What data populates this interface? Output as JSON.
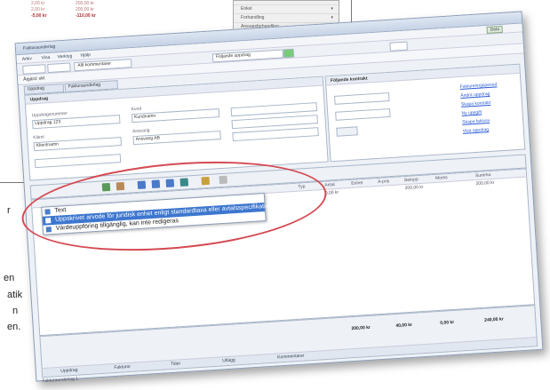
{
  "background": {
    "table_rows": [
      {
        "a": "2,00 kr",
        "b": "200,00 kr"
      },
      {
        "a": "2,00 kr",
        "b": "200,00 kr"
      },
      {
        "a": "-5,00 kr",
        "b": "-110,00 kr"
      }
    ],
    "menu_items": [
      "Enkel",
      "Forhandling",
      "Ansvarsforhandling"
    ],
    "side_text_left": [
      "r",
      "en",
      "atik",
      "n",
      "en."
    ]
  },
  "window": {
    "title": "Fakturaunderlag",
    "menu": [
      "Arkiv",
      "Visa",
      "Verktyg",
      "Hjälp"
    ],
    "right_button": "Dela",
    "toolbar": {
      "field1": "Allt kommentarer",
      "dropdown": "Följande uppdrag"
    },
    "filter_label": "Åtgärd: okt",
    "tabs": [
      "Uppdrag",
      "Fakturaunderlag"
    ],
    "left_panel": {
      "title": "Uppdrag",
      "fields": [
        {
          "label": "Uppdragsnummer",
          "value": "Uppdrag 123"
        },
        {
          "label": "Kund",
          "value": "Kundnamn"
        },
        {
          "label": "Klient",
          "value": "Klientnamn"
        },
        {
          "label": "Ansvarig",
          "value": "Ansvarig AB"
        }
      ]
    },
    "right_panel": {
      "title": "Följande kontrakt",
      "links": [
        "Faktureringsperiod",
        "Ändra uppdrag",
        "Skapa kontrakt",
        "Ny uppgift",
        "Skapa faktura",
        "Visa uppdrag"
      ]
    },
    "grid": {
      "headers": [
        "Typ",
        "Antal",
        "Enhet",
        "À-pris",
        "Belopp",
        "Moms",
        "Summa"
      ],
      "dropdown_items": [
        {
          "label": "Text",
          "selected": false
        },
        {
          "label": "Uppskrivet arvode för juridisk enhet enligt standardtaxa eller avtalsspecifikation",
          "selected": true
        },
        {
          "label": "Värdeuppföring tillgänglig, kan inte redigeras",
          "selected": false
        }
      ],
      "row_values": [
        "0,00 kr",
        "200,00 kr",
        "200,00 kr"
      ]
    },
    "footer": {
      "summaries": [
        "200,00 kr",
        "40,00 kr",
        "0,00 kr",
        "240,00 kr"
      ],
      "tabs": [
        "Uppdrag",
        "Fakturor",
        "Tider",
        "Utlägg",
        "Kommentarer"
      ]
    },
    "status": "Fakturaunderlag 1"
  },
  "colors": {
    "highlight_ellipse": "#d44a52",
    "selection": "#3c76cf"
  }
}
